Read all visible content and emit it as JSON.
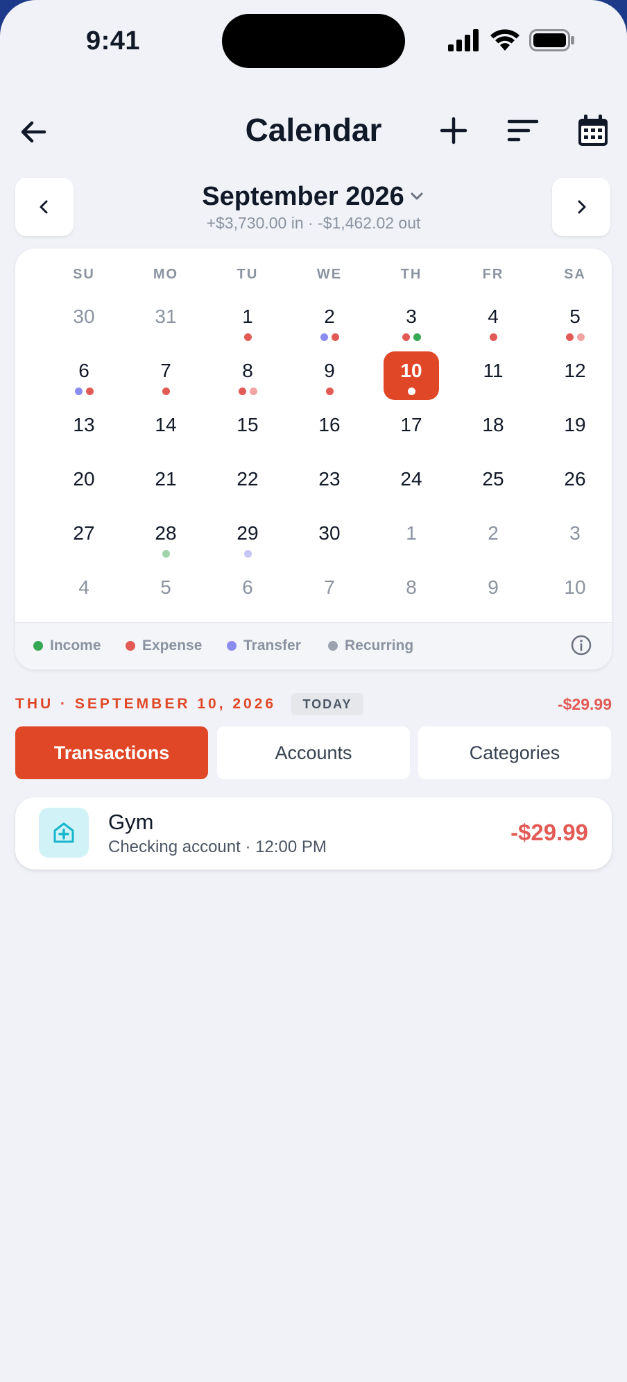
{
  "status_bar": {
    "time": "9:41"
  },
  "header": {
    "title": "Calendar"
  },
  "month_nav": {
    "month_label": "September 2026",
    "summary": "+$3,730.00 in · -$1,462.02 out"
  },
  "calendar": {
    "weekdays": [
      "SU",
      "MO",
      "TU",
      "WE",
      "TH",
      "FR",
      "SA"
    ],
    "days": [
      {
        "num": "30",
        "muted": true,
        "dots": []
      },
      {
        "num": "31",
        "muted": true,
        "dots": []
      },
      {
        "num": "1",
        "dots": [
          "expense"
        ]
      },
      {
        "num": "2",
        "dots": [
          "transfer",
          "expense"
        ]
      },
      {
        "num": "3",
        "dots": [
          "expense",
          "income"
        ]
      },
      {
        "num": "4",
        "dots": [
          "expense"
        ]
      },
      {
        "num": "5",
        "dots": [
          "expense",
          "expense-light"
        ]
      },
      {
        "num": "6",
        "dots": [
          "transfer",
          "expense"
        ]
      },
      {
        "num": "7",
        "dots": [
          "expense"
        ]
      },
      {
        "num": "8",
        "dots": [
          "expense",
          "expense-light"
        ]
      },
      {
        "num": "9",
        "dots": [
          "expense"
        ]
      },
      {
        "num": "10",
        "today": true,
        "dots": [
          "white"
        ]
      },
      {
        "num": "11",
        "dots": []
      },
      {
        "num": "12",
        "dots": []
      },
      {
        "num": "13",
        "dots": []
      },
      {
        "num": "14",
        "dots": []
      },
      {
        "num": "15",
        "dots": []
      },
      {
        "num": "16",
        "dots": []
      },
      {
        "num": "17",
        "dots": []
      },
      {
        "num": "18",
        "dots": []
      },
      {
        "num": "19",
        "dots": []
      },
      {
        "num": "20",
        "dots": []
      },
      {
        "num": "21",
        "dots": []
      },
      {
        "num": "22",
        "dots": []
      },
      {
        "num": "23",
        "dots": []
      },
      {
        "num": "24",
        "dots": []
      },
      {
        "num": "25",
        "dots": []
      },
      {
        "num": "26",
        "dots": []
      },
      {
        "num": "27",
        "dots": []
      },
      {
        "num": "28",
        "dots": [
          "income-light"
        ]
      },
      {
        "num": "29",
        "dots": [
          "transfer-light"
        ]
      },
      {
        "num": "30",
        "dots": []
      },
      {
        "num": "1",
        "muted": true,
        "dots": []
      },
      {
        "num": "2",
        "muted": true,
        "dots": []
      },
      {
        "num": "3",
        "muted": true,
        "dots": []
      },
      {
        "num": "4",
        "muted": true,
        "dots": []
      },
      {
        "num": "5",
        "muted": true,
        "dots": []
      },
      {
        "num": "6",
        "muted": true,
        "dots": []
      },
      {
        "num": "7",
        "muted": true,
        "dots": []
      },
      {
        "num": "8",
        "muted": true,
        "dots": []
      },
      {
        "num": "9",
        "muted": true,
        "dots": []
      },
      {
        "num": "10",
        "muted": true,
        "dots": []
      }
    ],
    "dot_colors": {
      "income": "#34a853",
      "income-light": "#9fd3a9",
      "expense": "#e25a55",
      "expense-light": "#f2a3a3",
      "transfer": "#8b8cf0",
      "transfer-light": "#c5c6f6",
      "recurring": "#9ca3af",
      "white": "#ffffff"
    }
  },
  "legend": {
    "income": "Income",
    "expense": "Expense",
    "transfer": "Transfer",
    "recurring": "Recurring"
  },
  "selected_day": {
    "date_label": "THU · SEPTEMBER 10, 2026",
    "badge": "TODAY",
    "total": "-$29.99"
  },
  "tabs": [
    "Transactions",
    "Accounts",
    "Categories"
  ],
  "transactions": [
    {
      "name": "Gym",
      "detail": "Checking account · 12:00 PM",
      "amount": "-$29.99",
      "icon": "gym-icon"
    }
  ],
  "colors": {
    "accent": "#e04727",
    "negative": "#e25a55",
    "gym_icon_bg": "#d1f3f8",
    "gym_icon_fg": "#17b6cc"
  }
}
